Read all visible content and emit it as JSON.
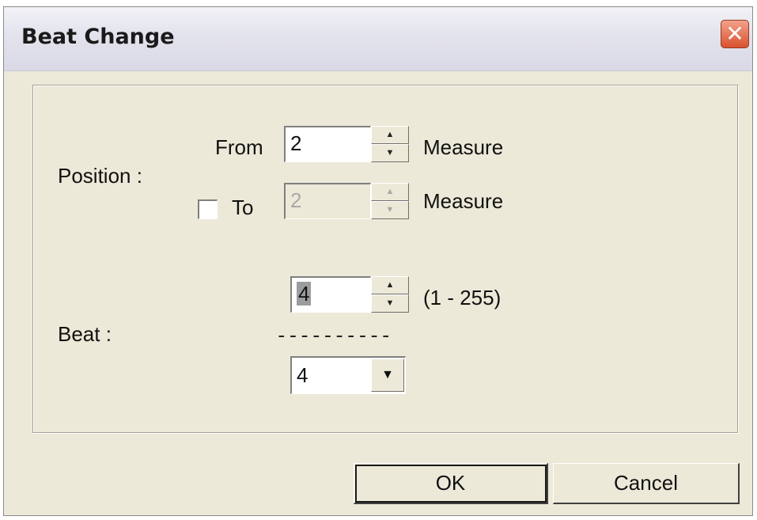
{
  "window": {
    "title": "Beat Change",
    "close_glyph": "✕"
  },
  "position": {
    "label": "Position :",
    "from_label": "From",
    "from_value": "2",
    "from_unit": "Measure",
    "to_checkbox_checked": false,
    "to_label": "To",
    "to_value": "2",
    "to_unit": "Measure"
  },
  "beat": {
    "label": "Beat :",
    "numerator_value": "4",
    "range_hint": "(1 - 255)",
    "divider": "----------",
    "denominator_value": "4"
  },
  "buttons": {
    "ok_label": "OK",
    "cancel_label": "Cancel"
  },
  "icons": {
    "close": "close-icon",
    "spin_up": "spin-up-icon",
    "spin_down": "spin-down-icon",
    "dropdown": "chevron-down-icon"
  }
}
